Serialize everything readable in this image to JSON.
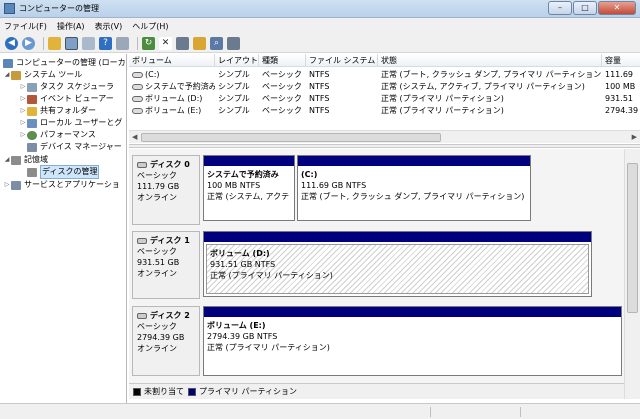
{
  "window": {
    "title": "コンピューターの管理",
    "buttons": {
      "minimize": "–",
      "maximize": "□",
      "close": "✕"
    }
  },
  "menu": [
    "ファイル(F)",
    "操作(A)",
    "表示(V)",
    "ヘルプ(H)"
  ],
  "toolbar_icons": [
    "back-arrow-icon",
    "forward-arrow-icon",
    "folder-up-icon",
    "console-tree-icon",
    "properties-icon",
    "help-icon",
    "view-icon",
    "refresh-icon",
    "delete-icon",
    "properties-sheet-icon",
    "open-folder-icon",
    "search-icon",
    "settings-icon"
  ],
  "tree": {
    "root": "コンピューターの管理 (ローカ",
    "system_tools": "システム ツール",
    "task_scheduler": "タスク スケジューラ",
    "event_viewer": "イベント ビューアー",
    "shared_folders": "共有フォルダー",
    "local_users": "ローカル ユーザーとグ",
    "performance": "パフォーマンス",
    "device_manager": "デバイス マネージャー",
    "storage": "記憶域",
    "disk_management": "ディスクの管理",
    "services_apps": "サービスとアプリケーショ"
  },
  "volume_list": {
    "columns": [
      "ボリューム",
      "レイアウト",
      "種類",
      "ファイル システム",
      "状態",
      "容量"
    ],
    "rows": [
      {
        "volume": "(C:)",
        "layout": "シンプル",
        "type": "ベーシック",
        "fs": "NTFS",
        "status": "正常 (ブート, クラッシュ ダンプ, プライマリ パーティション)",
        "capacity": "111.69"
      },
      {
        "volume": "システムで予約済み",
        "layout": "シンプル",
        "type": "ベーシック",
        "fs": "NTFS",
        "status": "正常 (システム, アクティブ, プライマリ パーティション)",
        "capacity": "100 MB"
      },
      {
        "volume": "ボリューム (D:)",
        "layout": "シンプル",
        "type": "ベーシック",
        "fs": "NTFS",
        "status": "正常 (プライマリ パーティション)",
        "capacity": "931.51"
      },
      {
        "volume": "ボリューム (E:)",
        "layout": "シンプル",
        "type": "ベーシック",
        "fs": "NTFS",
        "status": "正常 (プライマリ パーティション)",
        "capacity": "2794.39"
      }
    ]
  },
  "disks": [
    {
      "name": "ディスク 0",
      "type": "ベーシック",
      "size": "111.79 GB",
      "state": "オンライン",
      "partitions": [
        {
          "label": "システムで予約済み",
          "size": "100 MB NTFS",
          "status": "正常 (システム, アクテ・"
        },
        {
          "label": "(C:)",
          "size": "111.69 GB NTFS",
          "status": "正常 (ブート, クラッシュ ダンプ, プライマリ パーティション)"
        }
      ]
    },
    {
      "name": "ディスク 1",
      "type": "ベーシック",
      "size": "931.51 GB",
      "state": "オンライン",
      "partitions": [
        {
          "label": "ボリューム  (D:)",
          "size": "931.51 GB NTFS",
          "status": "正常 (プライマリ パーティション)"
        }
      ]
    },
    {
      "name": "ディスク 2",
      "type": "ベーシック",
      "size": "2794.39 GB",
      "state": "オンライン",
      "partitions": [
        {
          "label": "ボリューム  (E:)",
          "size": "2794.39 GB NTFS",
          "status": "正常 (プライマリ パーティション)"
        }
      ]
    }
  ],
  "legend": {
    "unallocated": "未割り当て",
    "primary": "プライマリ パーティション"
  },
  "colors": {
    "primary_partition": "#00007f",
    "unallocated": "#000000",
    "selection": "#cde6fa"
  }
}
